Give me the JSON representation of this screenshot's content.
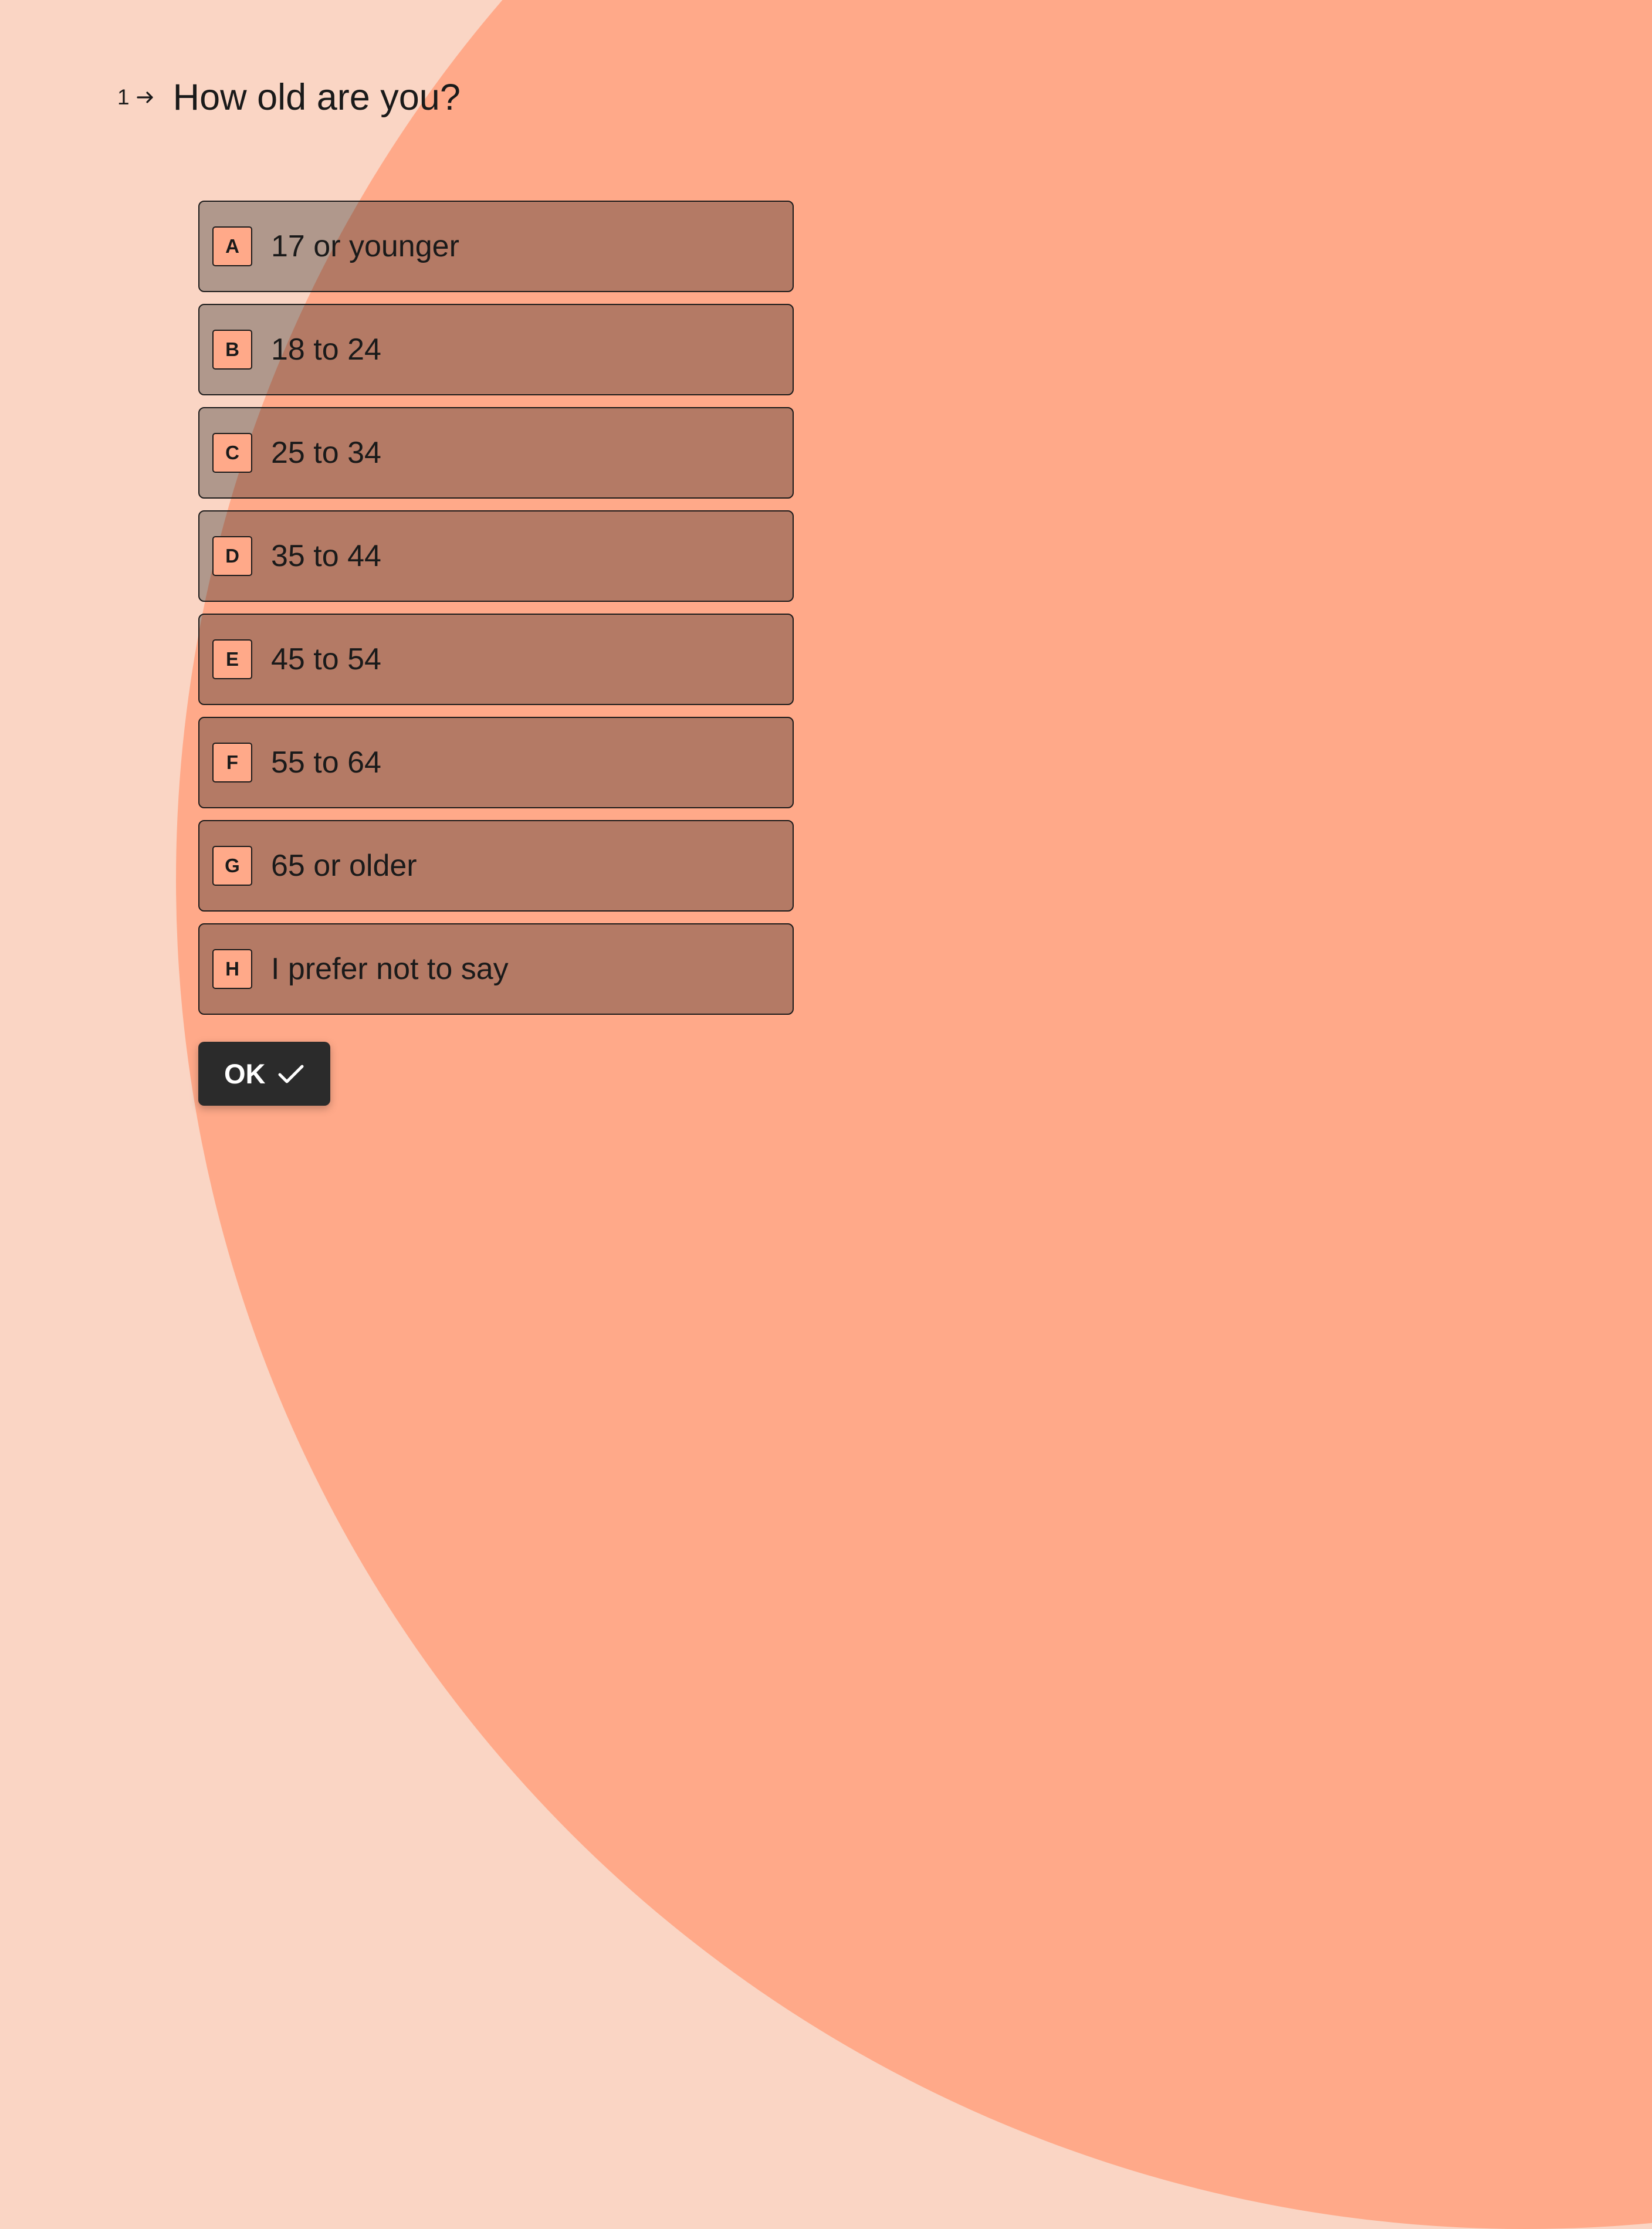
{
  "question": {
    "number": "1",
    "text": "How old are you?"
  },
  "options": [
    {
      "key": "A",
      "label": "17 or younger"
    },
    {
      "key": "B",
      "label": "18 to 24"
    },
    {
      "key": "C",
      "label": "25 to 34"
    },
    {
      "key": "D",
      "label": "35 to 44"
    },
    {
      "key": "E",
      "label": "45 to 54"
    },
    {
      "key": "F",
      "label": "55 to 64"
    },
    {
      "key": "G",
      "label": "65 or older"
    },
    {
      "key": "H",
      "label": "I prefer not to say"
    }
  ],
  "submit": {
    "label": "OK"
  }
}
